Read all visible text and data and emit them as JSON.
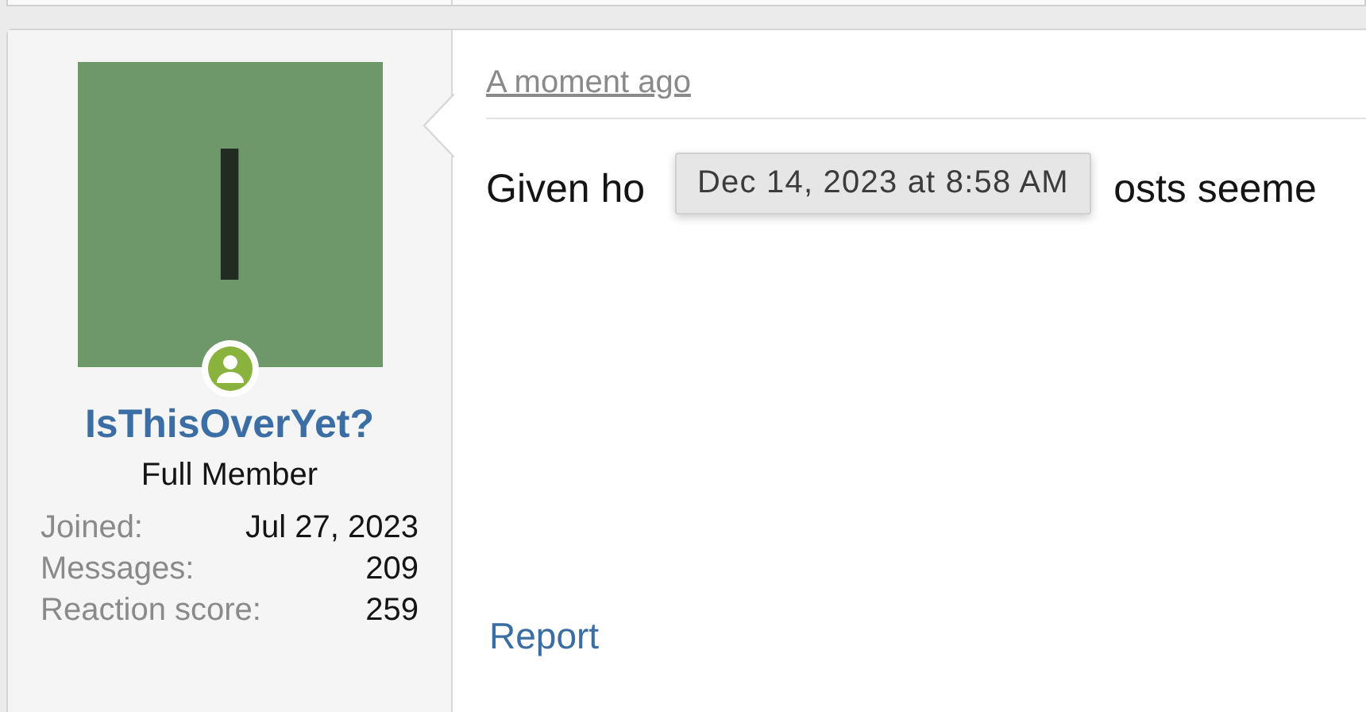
{
  "user": {
    "avatar_letter": "I",
    "online": true,
    "name": "IsThisOverYet?",
    "title": "Full Member",
    "stats": [
      {
        "label": "Joined:",
        "value": "Jul 27, 2023"
      },
      {
        "label": "Messages:",
        "value": "209"
      },
      {
        "label": "Reaction score:",
        "value": "259"
      }
    ]
  },
  "post": {
    "time": "A moment ago",
    "tooltip": "Dec 14, 2023 at 8:58 AM",
    "body_start": "Given ho",
    "body_end": "osts seeme",
    "report": "Report"
  }
}
